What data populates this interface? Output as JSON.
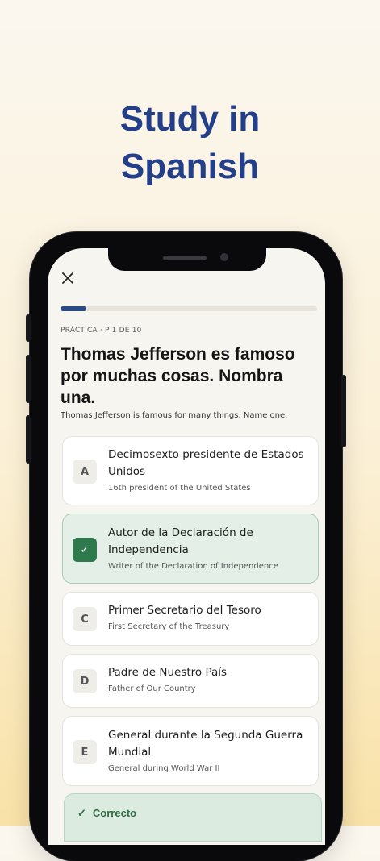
{
  "headline": {
    "line1": "Study in",
    "line2": "Spanish"
  },
  "quiz": {
    "meta": "PRÁCTICA · P 1 DE 10",
    "progress_fraction": 0.1,
    "question": "Thomas Jefferson es famoso por muchas cosas. Nombra una.",
    "question_translation": "Thomas Jefferson is famous for many things. Name one.",
    "options": [
      {
        "letter": "A",
        "title": "Decimosexto presidente de Estados Unidos",
        "subtitle": "16th president of the United States",
        "selected": false
      },
      {
        "letter": "✓",
        "title": "Autor de la Declaración de Independencia",
        "subtitle": "Writer of the Declaration of Independence",
        "selected": true
      },
      {
        "letter": "C",
        "title": "Primer Secretario del Tesoro",
        "subtitle": "First Secretary of the Treasury",
        "selected": false
      },
      {
        "letter": "D",
        "title": "Padre de Nuestro País",
        "subtitle": "Father of Our Country",
        "selected": false
      },
      {
        "letter": "E",
        "title": "General durante la Segunda Guerra Mundial",
        "subtitle": "General during World War II",
        "selected": false
      }
    ],
    "feedback": {
      "icon": "✓",
      "label": "Correcto"
    }
  },
  "colors": {
    "headline": "#243f8a",
    "progress": "#2b4a86",
    "correct": "#2f7a4c"
  },
  "icons": {
    "close": "close-icon",
    "check": "check-icon"
  }
}
